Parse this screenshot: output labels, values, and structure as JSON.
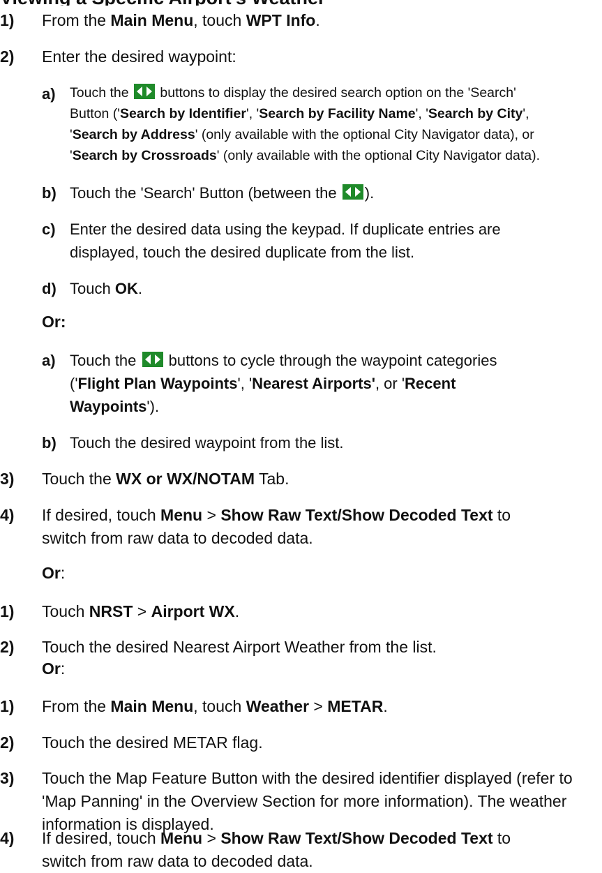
{
  "header": {
    "text": "Viewing a Specific Airport's Weather"
  },
  "steps1": [
    {
      "num": "1)",
      "parts": [
        "From the ",
        "Main Menu",
        ", touch ",
        "WPT Info",
        "."
      ]
    },
    {
      "num": "2)",
      "parts": [
        "Enter the desired waypoint:"
      ]
    }
  ],
  "substeps_a": [
    {
      "num": "a)",
      "line1_pre": "Touch the ",
      "line1_post": " buttons to display the desired search option on the 'Search'",
      "line2": [
        "Button ('",
        "Search by Identifier",
        "', '",
        "Search by Facility Name",
        "', '",
        "Search by City",
        "',"
      ],
      "line3": [
        "'",
        "Search by Address",
        "' (only available with the optional City Navigator data), or"
      ],
      "line4": [
        "'",
        "Search by Crossroads",
        "' (only available with the optional City Navigator data)."
      ]
    },
    {
      "num": "b)",
      "pre": "Touch the 'Search' Button (between the ",
      "post": ")."
    },
    {
      "num": "c)",
      "line1": "Enter the desired data using the keypad.  If duplicate entries are",
      "line2": "displayed, touch the desired duplicate from the list."
    },
    {
      "num": "d)",
      "pre": "Touch ",
      "bold": "OK",
      "post": "."
    }
  ],
  "or_label_colon": "Or:",
  "substeps_b": [
    {
      "num": "a)",
      "line1_pre": "Touch the ",
      "line1_post": " buttons to cycle through the waypoint categories",
      "line2": [
        "('",
        "Flight Plan Waypoints",
        "', '",
        "Nearest Airports'",
        ", or '",
        "Recent"
      ],
      "line3": [
        "Waypoints",
        "')."
      ]
    },
    {
      "num": "b)",
      "text": "Touch the desired waypoint from the list."
    }
  ],
  "steps2": [
    {
      "num": "3)",
      "parts": [
        "Touch the ",
        "WX or WX/NOTAM",
        " Tab."
      ]
    },
    {
      "num": "4)",
      "parts": [
        "If desired, touch ",
        "Menu",
        " > ",
        "Show Raw Text/Show Decoded Text",
        " to"
      ],
      "line2": "switch from raw data to decoded data."
    }
  ],
  "or_label": "Or",
  "colon": ":",
  "steps3": [
    {
      "num": "1)",
      "parts": [
        "Touch ",
        "NRST",
        " > ",
        "Airport WX",
        "."
      ]
    },
    {
      "num": "2)",
      "text": "Touch the desired Nearest Airport Weather from the list."
    }
  ],
  "steps4": [
    {
      "num": "1)",
      "parts": [
        "From the ",
        "Main Menu",
        ", touch ",
        "Weather",
        " > ",
        "METAR",
        "."
      ]
    },
    {
      "num": "2)",
      "text": "Touch the desired METAR flag."
    },
    {
      "num": "3)",
      "line1": "Touch the Map Feature Button with the desired identifier displayed (refer to",
      "line2": "'Map Panning' in the Overview Section for more information).  The weather",
      "line3": "information is displayed."
    },
    {
      "num": "4)",
      "parts": [
        "If desired, touch ",
        "Menu",
        " > ",
        "Show Raw Text/Show Decoded Text",
        " to"
      ],
      "line2": "switch from raw data to decoded data."
    }
  ],
  "icon_colors": {
    "bg": "#1f8a2a",
    "arrow": "#ffffff"
  }
}
